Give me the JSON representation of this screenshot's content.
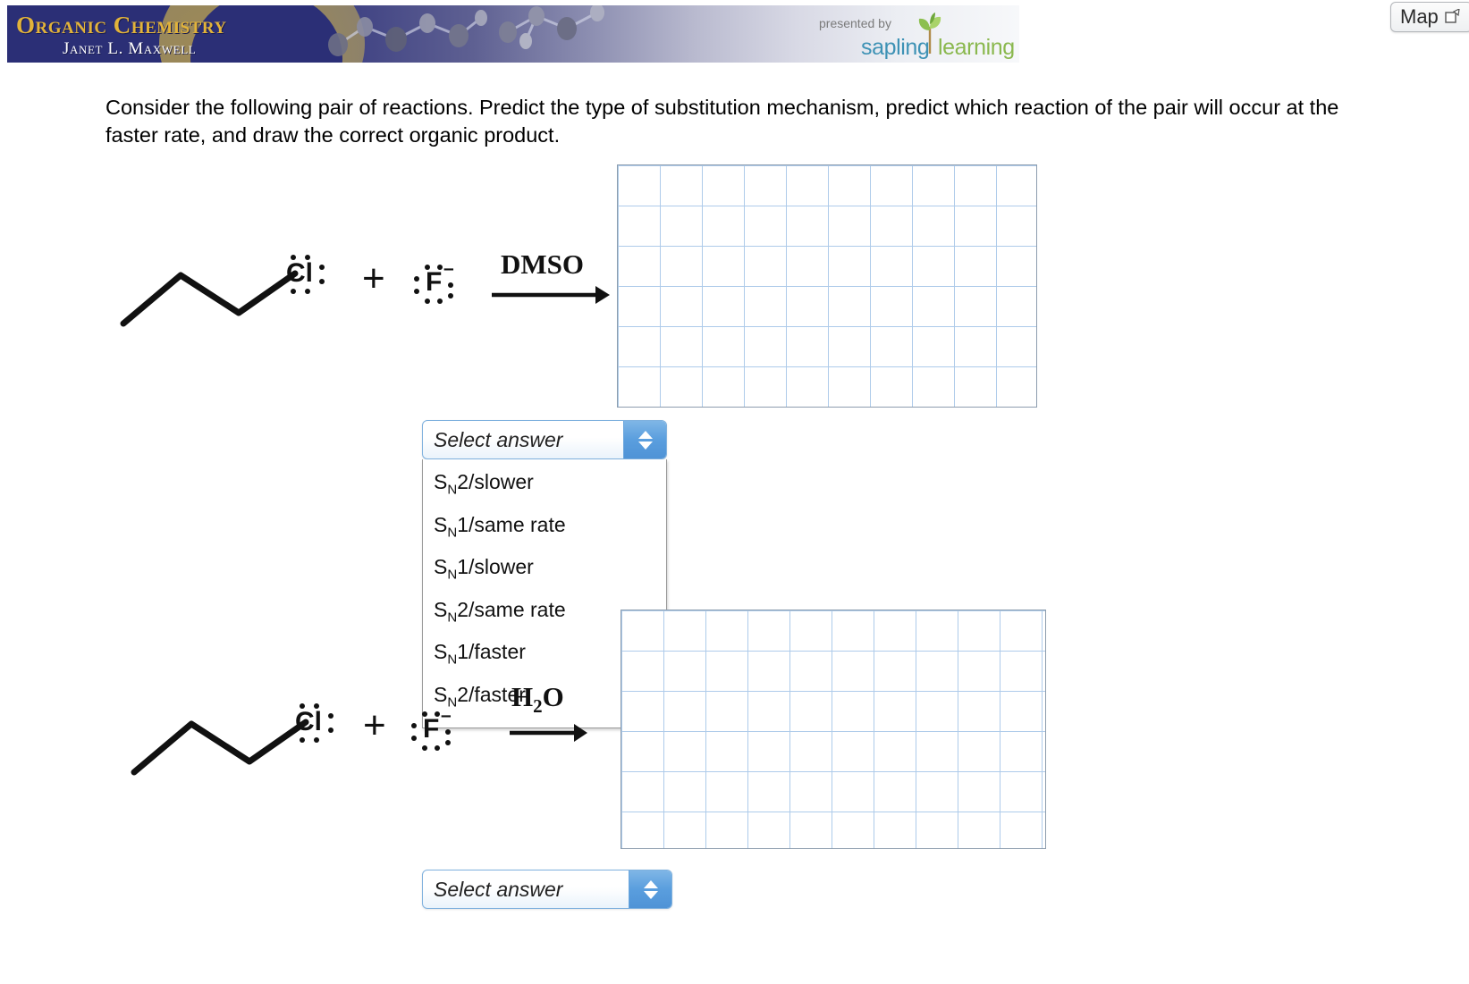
{
  "header": {
    "brand_title": "Organic Chemistry",
    "brand_subtitle": "Janet L. Maxwell",
    "presented_by": "presented by",
    "sapling_word": "sapling",
    "learning_word": "learning",
    "map_button": "Map"
  },
  "prompt": "Consider the following pair of reactions. Predict the type of substitution mechanism, predict which reaction of the pair will occur at the faster rate, and draw the correct organic product.",
  "reactions": [
    {
      "id": "reaction-1",
      "substrate_label": "Cl",
      "plus": "+",
      "nucleophile_label": "F",
      "nucleophile_charge": "−",
      "solvent": "DMSO",
      "solvent_parts": {
        "main": "DMSO",
        "sub": ""
      }
    },
    {
      "id": "reaction-2",
      "substrate_label": "Cl",
      "plus": "+",
      "nucleophile_label": "F",
      "nucleophile_charge": "−",
      "solvent": "H2O",
      "solvent_parts": {
        "main_a": "H",
        "sub": "2",
        "main_b": "O"
      }
    }
  ],
  "selects": [
    {
      "id": "select-answer-1",
      "value": "Select answer",
      "expanded": true
    },
    {
      "id": "select-answer-2",
      "value": "Select answer",
      "expanded": false
    }
  ],
  "dropdown_options": [
    {
      "prefix": "S",
      "sub": "N",
      "rest": "2/slower"
    },
    {
      "prefix": "S",
      "sub": "N",
      "rest": "1/same rate"
    },
    {
      "prefix": "S",
      "sub": "N",
      "rest": "1/slower"
    },
    {
      "prefix": "S",
      "sub": "N",
      "rest": "2/same rate"
    },
    {
      "prefix": "S",
      "sub": "N",
      "rest": "1/faster"
    },
    {
      "prefix": "S",
      "sub": "N",
      "rest": "2/faster"
    }
  ],
  "colors": {
    "banner_navy": "#2b2f76",
    "brand_gold": "#e2b33a",
    "sapling_blue": "#3e92b5",
    "learning_green": "#8ab84e",
    "grid_line": "#aecbea",
    "grid_border": "#8d9dae",
    "select_accent": "#5a9ede"
  }
}
